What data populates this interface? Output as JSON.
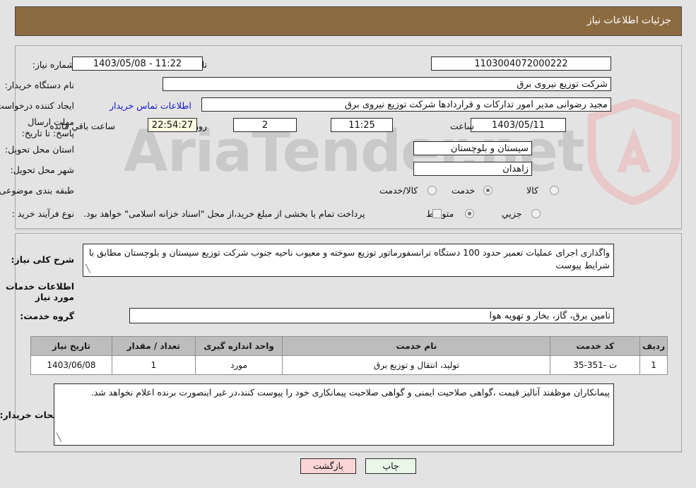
{
  "header": {
    "title": "جزئیات اطلاعات نیاز"
  },
  "top_form": {
    "need_number_label": "شماره نیاز:",
    "need_number_value": "1103004072000222",
    "announce_label": "تاریخ و ساعت اعلان عمومی:",
    "announce_value": "11:22 - 1403/05/08",
    "buyer_org_label": "نام دستگاه خریدار:",
    "buyer_org_value": "شرکت توزیع نیروی برق",
    "creator_label": "ایجاد کننده درخواست:",
    "creator_value": "مجید  رضوانی مدیر امور تدارکات و قراردادها شرکت توزیع نیروی برق",
    "contact_link": "اطلاعات تماس خریدار",
    "deadline_label": "مهلت ارسال پاسخ: تا تاریخ:",
    "deadline_date": "1403/05/11",
    "hour_label": "ساعت",
    "deadline_time": "11:25",
    "days_value": "2",
    "days_label": "روز و",
    "countdown_value": "22:54:27",
    "remaining_label": "ساعت باقي مانده",
    "province_label": "استان محل تحویل:",
    "province_value": "سیستان و بلوچستان",
    "city_label": "شهر محل تحویل:",
    "city_value": "زاهدان",
    "category_label": "طبقه بندی موضوعی:",
    "category_options": [
      {
        "label": "کالا",
        "selected": false
      },
      {
        "label": "خدمت",
        "selected": true
      },
      {
        "label": "کالا/خدمت",
        "selected": false
      }
    ],
    "process_label": "نوع فرآیند خرید :",
    "process_options": [
      {
        "label": "جزیي",
        "selected": false
      },
      {
        "label": "متوسط",
        "selected": true
      }
    ],
    "treasury_checkbox_label": "پرداخت تمام یا بخشی از مبلغ خرید،از محل \"اسناد خزانه اسلامی\" خواهد بود.",
    "treasury_checked": false
  },
  "description": {
    "label": "شرح کلی نیاز:",
    "value": "واگذاری اجرای عملیات تعمیر حدود 100 دستگاه ترانسفورماتور توزیع سوخته و معیوب ناحیه جنوب شرکت توزیع سیستان و بلوچستان مطابق با شرایط پیوست"
  },
  "services_section": {
    "heading": "اطلاعات خدمات مورد نیاز",
    "group_label": "گروه خدمت:",
    "group_value": "تامین برق، گاز، بخار و تهویه هوا",
    "table": {
      "columns": [
        "ردیف",
        "کد خدمت",
        "نام خدمت",
        "واحد اندازه گیری",
        "تعداد / مقدار",
        "تاریخ نیاز"
      ],
      "rows": [
        {
          "row_no": "1",
          "service_code": "ت -351-35",
          "service_name": "تولید، انتقال و توزیع برق",
          "unit": "مورد",
          "quantity": "1",
          "need_date": "1403/06/08"
        }
      ]
    }
  },
  "buyer_notes": {
    "label": "توضیحات خریدار:",
    "value": "پیمانکاران موظفند آنالیز قیمت ،گواهی صلاحیت ایمنی و گواهی صلاحیت پیمانکاری خود را پیوست کنند،در غیر اینصورت برنده اعلام نخواهد شد."
  },
  "footer": {
    "print_label": "چاپ",
    "back_label": "بازگشت"
  },
  "watermark": {
    "text": "AriaTender.net"
  },
  "colors": {
    "header_bg": "#8c6b40",
    "page_bg": "#e3e3e3",
    "link": "#1414cc",
    "table_header_bg": "#bdbdbd",
    "print_btn_bg": "#e9f7e9",
    "back_btn_bg": "#fbd5d5",
    "countdown_bg": "#fbfbe3"
  }
}
